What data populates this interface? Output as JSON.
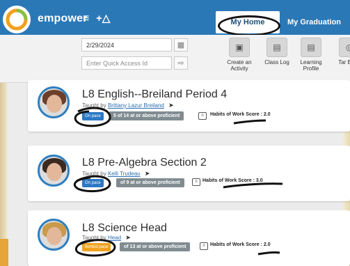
{
  "header": {
    "brand": "empower",
    "menu_icon": "hamburger-icon",
    "tools_icon": "plus-triangle-icon",
    "tabs": [
      {
        "label": "My Home",
        "active": true
      },
      {
        "label": "My Graduation",
        "active": false
      }
    ]
  },
  "toolbar": {
    "date_value": "2/29/2024",
    "quick_access_placeholder": "Enter Quick Access Id",
    "calendar_icon": "calendar-icon",
    "go_icon": "arrow-in-icon",
    "tools": [
      {
        "label": "Create an Activity",
        "icon": "monitor-icon"
      },
      {
        "label": "Class Log",
        "icon": "clipboard-icon"
      },
      {
        "label": "Learning Profile",
        "icon": "clipboard-icon"
      },
      {
        "label": "Tar Brow",
        "icon": "target-icon"
      }
    ]
  },
  "cards": [
    {
      "title": "L8 English--Breiland Period 4",
      "taught_by": "Taught by",
      "teacher": "Brittany Lazur Breiland",
      "status": "On pace",
      "proficiency": "5 of 14 at or above proficient",
      "habits_label": "Habits of Work Score : 2.0"
    },
    {
      "title": "L8 Pre-Algebra Section 2",
      "taught_by": "Taught by",
      "teacher": "Kelli Trudeau",
      "status": "On pace",
      "proficiency": "of 9 at or above proficient",
      "habits_label": "Habits of Work Score : 3.0"
    },
    {
      "title": "L8 Science Head",
      "taught_by": "Taught by",
      "teacher": "Head",
      "status": "Behind pace",
      "proficiency": "of 13 at or above proficient",
      "habits_label": "Habits of Work Score : 2.0"
    }
  ],
  "colors": {
    "header_blue": "#2b78b7",
    "pill_blue": "#2b78c4",
    "pill_orange": "#f0a21e",
    "badge_gray": "#808c91"
  }
}
